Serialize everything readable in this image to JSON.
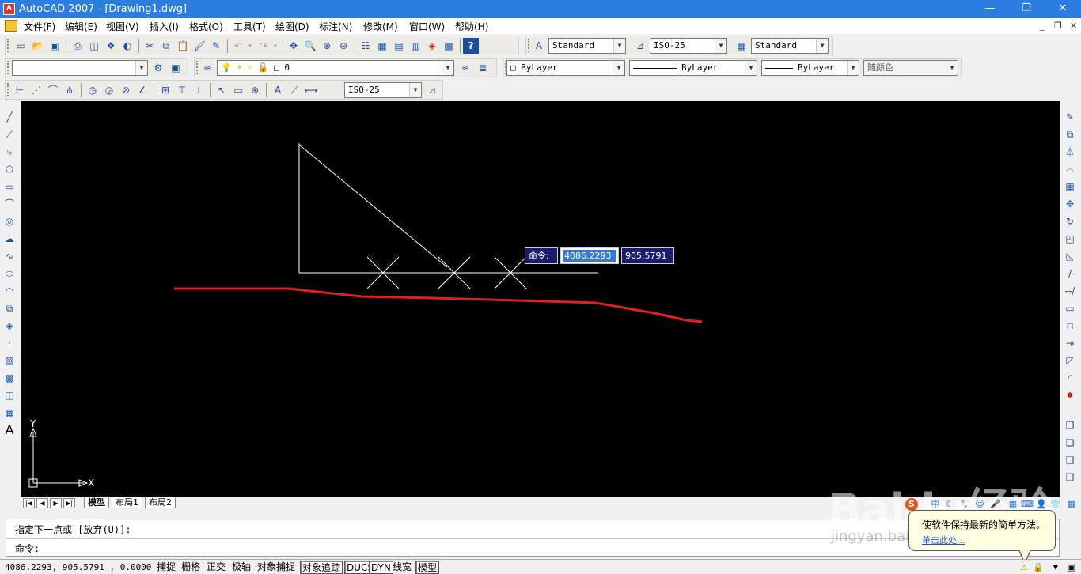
{
  "window": {
    "title": "AutoCAD 2007 - [Drawing1.dwg]",
    "app_icon": "autocad-icon",
    "controls": [
      "—",
      "❐",
      "✕"
    ],
    "mdi_controls": [
      "_",
      "❐",
      "✕"
    ]
  },
  "menu": [
    "文件(F)",
    "编辑(E)",
    "视图(V)",
    "插入(I)",
    "格式(O)",
    "工具(T)",
    "绘图(D)",
    "标注(N)",
    "修改(M)",
    "窗口(W)",
    "帮助(H)"
  ],
  "toolbar1": {
    "text_style": "Standard",
    "dim_style": "ISO-25",
    "table_style": "Standard"
  },
  "toolbar2": {
    "workspace": "",
    "layer": "0",
    "color": "ByLayer",
    "linetype": "ByLayer",
    "lineweight": "ByLayer",
    "plotstyle": "随颜色"
  },
  "toolbar3": {
    "dim_style": "ISO-25"
  },
  "dynamic_input": {
    "label": "命令:",
    "x_value": "4086.2293",
    "y_value": "905.5791"
  },
  "ucs": {
    "x": "X",
    "y": "Y"
  },
  "layout_tabs": [
    "模型",
    "布局1",
    "布局2"
  ],
  "command": {
    "history": "指定下一点或 [放弃(U)]:",
    "prompt": "命令:"
  },
  "status": {
    "coords": "4086.2293, 905.5791 , 0.0000",
    "buttons": [
      {
        "label": "捕捉",
        "on": false
      },
      {
        "label": "栅格",
        "on": false
      },
      {
        "label": "正交",
        "on": false
      },
      {
        "label": "极轴",
        "on": false
      },
      {
        "label": "对象捕捉",
        "on": false
      },
      {
        "label": "对象追踪",
        "on": true
      },
      {
        "label": "DUCS",
        "on": true
      },
      {
        "label": "DYN",
        "on": true
      },
      {
        "label": "线宽",
        "on": false
      },
      {
        "label": "模型",
        "on": true
      }
    ]
  },
  "balloon": {
    "text": "使软件保持最新的简单方法。",
    "link": "单击此处..."
  },
  "watermark": {
    "brand": "Baidu经验",
    "url": "jingyan.baidu.com"
  },
  "colors": {
    "canvas": "#000000",
    "red_line": "#e0201f",
    "titlebar": "#2b7de0"
  }
}
